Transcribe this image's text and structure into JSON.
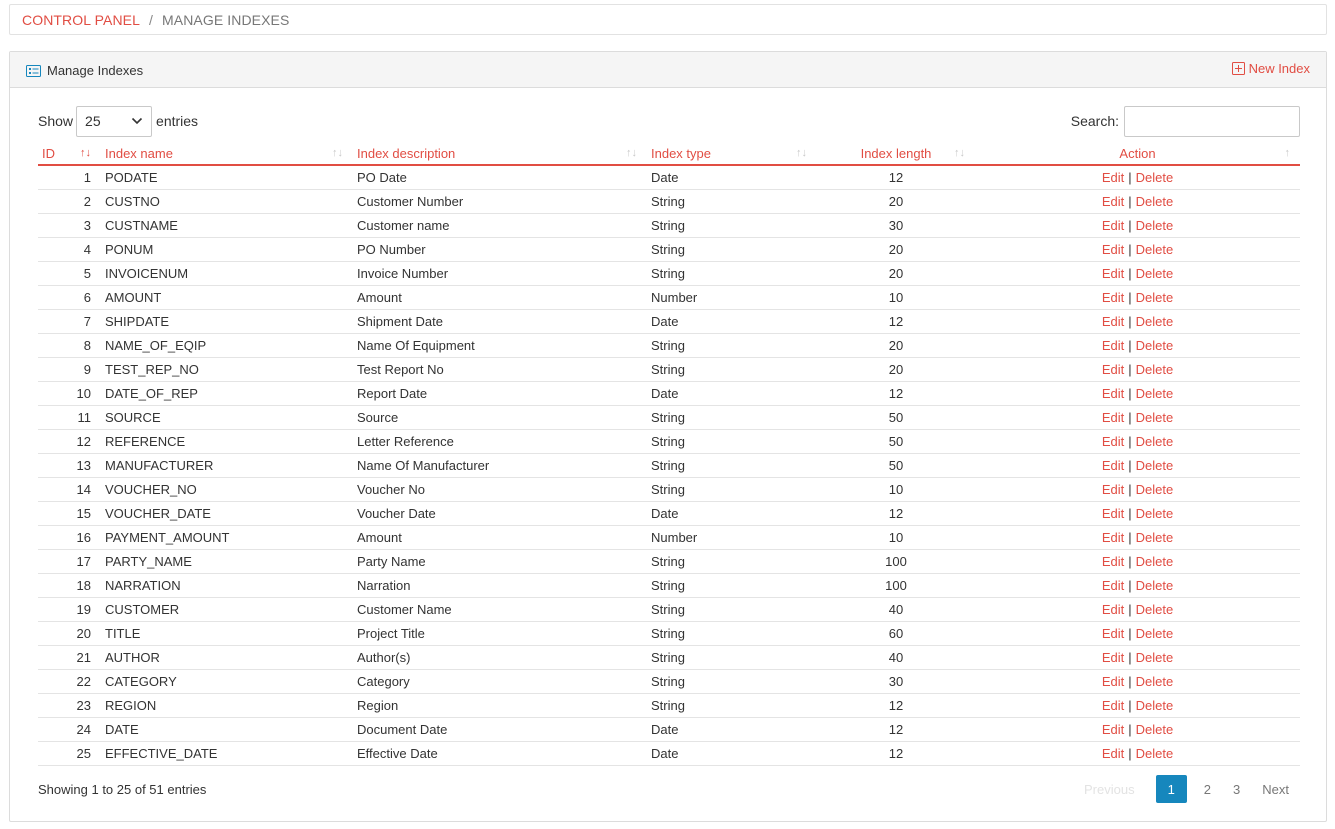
{
  "breadcrumb": {
    "root": "CONTROL PANEL",
    "separator": "/",
    "current": "MANAGE INDEXES"
  },
  "panel": {
    "title": "Manage Indexes",
    "new_button": "New Index"
  },
  "length": {
    "show": "Show",
    "value": "25",
    "entries": "entries"
  },
  "search": {
    "label": "Search:",
    "value": "",
    "placeholder": ""
  },
  "columns": {
    "id": "ID",
    "name": "Index name",
    "description": "Index description",
    "type": "Index type",
    "length": "Index length",
    "action": "Action"
  },
  "actions": {
    "edit": "Edit",
    "sep": "|",
    "delete": "Delete"
  },
  "rows": [
    {
      "id": "1",
      "name": "PODATE",
      "description": "PO Date",
      "type": "Date",
      "length": "12"
    },
    {
      "id": "2",
      "name": "CUSTNO",
      "description": "Customer Number",
      "type": "String",
      "length": "20"
    },
    {
      "id": "3",
      "name": "CUSTNAME",
      "description": "Customer name",
      "type": "String",
      "length": "30"
    },
    {
      "id": "4",
      "name": "PONUM",
      "description": "PO Number",
      "type": "String",
      "length": "20"
    },
    {
      "id": "5",
      "name": "INVOICENUM",
      "description": "Invoice Number",
      "type": "String",
      "length": "20"
    },
    {
      "id": "6",
      "name": "AMOUNT",
      "description": "Amount",
      "type": "Number",
      "length": "10"
    },
    {
      "id": "7",
      "name": "SHIPDATE",
      "description": "Shipment Date",
      "type": "Date",
      "length": "12"
    },
    {
      "id": "8",
      "name": "NAME_OF_EQIP",
      "description": "Name Of Equipment",
      "type": "String",
      "length": "20"
    },
    {
      "id": "9",
      "name": "TEST_REP_NO",
      "description": "Test Report No",
      "type": "String",
      "length": "20"
    },
    {
      "id": "10",
      "name": "DATE_OF_REP",
      "description": "Report Date",
      "type": "Date",
      "length": "12"
    },
    {
      "id": "11",
      "name": "SOURCE",
      "description": "Source",
      "type": "String",
      "length": "50"
    },
    {
      "id": "12",
      "name": "REFERENCE",
      "description": "Letter Reference",
      "type": "String",
      "length": "50"
    },
    {
      "id": "13",
      "name": "MANUFACTURER",
      "description": "Name Of Manufacturer",
      "type": "String",
      "length": "50"
    },
    {
      "id": "14",
      "name": "VOUCHER_NO",
      "description": "Voucher No",
      "type": "String",
      "length": "10"
    },
    {
      "id": "15",
      "name": "VOUCHER_DATE",
      "description": "Voucher Date",
      "type": "Date",
      "length": "12"
    },
    {
      "id": "16",
      "name": "PAYMENT_AMOUNT",
      "description": "Amount",
      "type": "Number",
      "length": "10"
    },
    {
      "id": "17",
      "name": "PARTY_NAME",
      "description": "Party Name",
      "type": "String",
      "length": "100"
    },
    {
      "id": "18",
      "name": "NARRATION",
      "description": "Narration",
      "type": "String",
      "length": "100"
    },
    {
      "id": "19",
      "name": "CUSTOMER",
      "description": "Customer Name",
      "type": "String",
      "length": "40"
    },
    {
      "id": "20",
      "name": "TITLE",
      "description": "Project Title",
      "type": "String",
      "length": "60"
    },
    {
      "id": "21",
      "name": "AUTHOR",
      "description": "Author(s)",
      "type": "String",
      "length": "40"
    },
    {
      "id": "22",
      "name": "CATEGORY",
      "description": "Category",
      "type": "String",
      "length": "30"
    },
    {
      "id": "23",
      "name": "REGION",
      "description": "Region",
      "type": "String",
      "length": "12"
    },
    {
      "id": "24",
      "name": "DATE",
      "description": "Document Date",
      "type": "Date",
      "length": "12"
    },
    {
      "id": "25",
      "name": "EFFECTIVE_DATE",
      "description": "Effective Date",
      "type": "Date",
      "length": "12"
    }
  ],
  "footer": {
    "info": "Showing 1 to 25 of 51 entries"
  },
  "pagination": {
    "previous": "Previous",
    "pages": [
      "1",
      "2",
      "3"
    ],
    "current": "1",
    "next": "Next"
  },
  "colors": {
    "accent": "#e14d43",
    "page_active": "#1687bd"
  },
  "icons": {
    "panel": "list-card-icon",
    "new": "plus-square-icon",
    "select": "chevron-down-icon"
  }
}
